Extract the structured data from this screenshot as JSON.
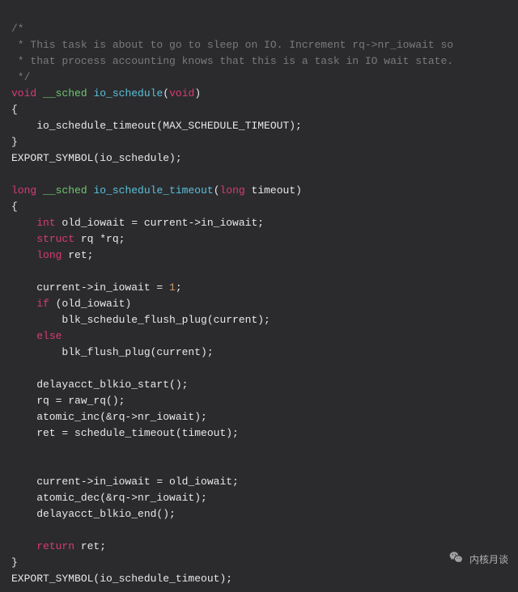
{
  "code": {
    "l1": "/*",
    "l2": " * This task is about to go to sleep on IO. Increment rq->nr_iowait so",
    "l3": " * that process accounting knows that this is a task in IO wait state.",
    "l4": " */",
    "l5_kw1": "void",
    "l5_at": "__sched",
    "l5_fn": "io_schedule",
    "l5_kw2": "void",
    "l6": "{",
    "l7": "    io_schedule_timeout(MAX_SCHEDULE_TIMEOUT);",
    "l8": "}",
    "l9": "EXPORT_SYMBOL(io_schedule);",
    "l10": "",
    "l11_kw1": "long",
    "l11_at": "__sched",
    "l11_fn": "io_schedule_timeout",
    "l11_kw2": "long",
    "l11_param": " timeout)",
    "l12": "{",
    "l13_kw": "int",
    "l13_rest": " old_iowait = current->in_iowait;",
    "l14_kw": "struct",
    "l14_rest": " rq *rq;",
    "l15_kw": "long",
    "l15_rest": " ret;",
    "l16": "",
    "l17a": "    current->in_iowait = ",
    "l17n": "1",
    "l17b": ";",
    "l18_kw": "if",
    "l18_rest": " (old_iowait)",
    "l19": "        blk_schedule_flush_plug(current);",
    "l20_kw": "else",
    "l21": "        blk_flush_plug(current);",
    "l22": "",
    "l23": "    delayacct_blkio_start();",
    "l24": "    rq = raw_rq();",
    "l25": "    atomic_inc(&rq->nr_iowait);",
    "l26": "    ret = schedule_timeout(timeout);",
    "l27": "",
    "l28": "",
    "l29": "    current->in_iowait = old_iowait;",
    "l30": "    atomic_dec(&rq->nr_iowait);",
    "l31": "    delayacct_blkio_end();",
    "l32": "",
    "l33_kw": "return",
    "l33_rest": " ret;",
    "l34": "}",
    "l35": "EXPORT_SYMBOL(io_schedule_timeout);"
  },
  "watermark": {
    "text": "内核月谈",
    "icon": "wechat-icon"
  }
}
